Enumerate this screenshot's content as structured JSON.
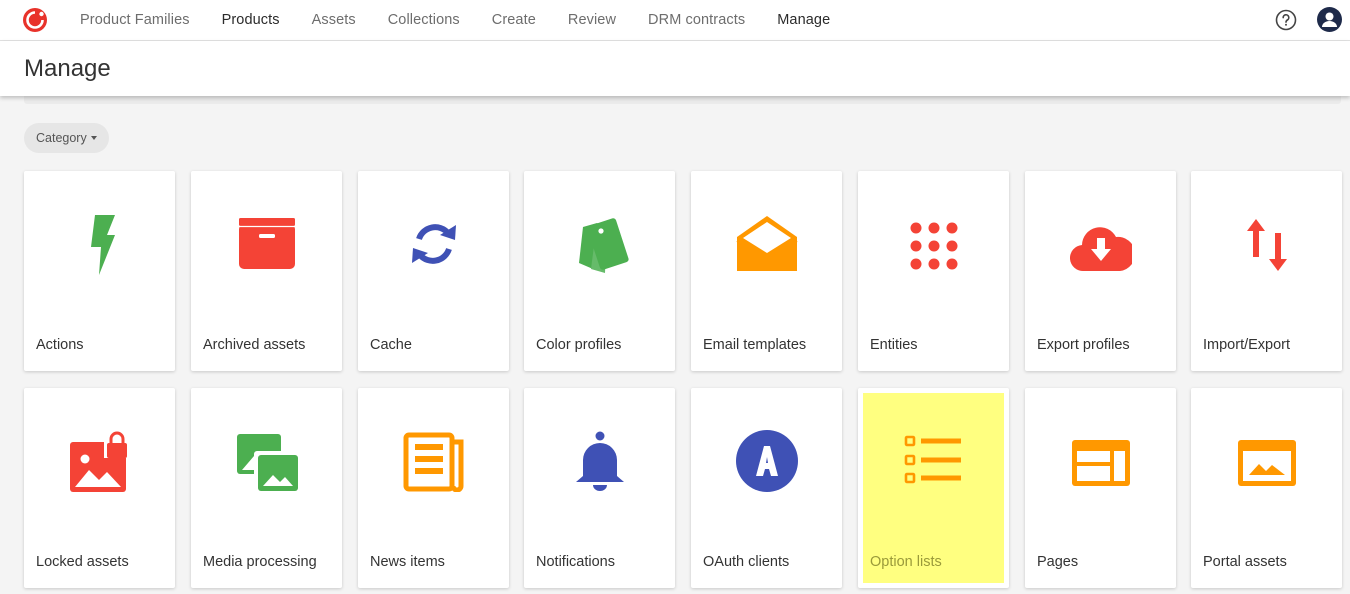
{
  "nav": {
    "items": [
      {
        "label": "Product Families",
        "dark": false
      },
      {
        "label": "Products",
        "dark": true
      },
      {
        "label": "Assets",
        "dark": false
      },
      {
        "label": "Collections",
        "dark": false
      },
      {
        "label": "Create",
        "dark": false
      },
      {
        "label": "Review",
        "dark": false
      },
      {
        "label": "DRM contracts",
        "dark": false
      },
      {
        "label": "Manage",
        "dark": true
      }
    ]
  },
  "header": {
    "title": "Manage"
  },
  "filter": {
    "category_label": "Category"
  },
  "colors": {
    "green": "#4caf50",
    "red": "#f44336",
    "blue": "#3f51b5",
    "orange": "#ff9800",
    "highlight": "#ffff80",
    "brand": "#e8322a"
  },
  "tiles": [
    {
      "label": "Actions",
      "icon": "lightning-icon"
    },
    {
      "label": "Archived assets",
      "icon": "archive-box-icon"
    },
    {
      "label": "Cache",
      "icon": "sync-icon"
    },
    {
      "label": "Color profiles",
      "icon": "color-swatches-icon"
    },
    {
      "label": "Email templates",
      "icon": "open-envelope-icon"
    },
    {
      "label": "Entities",
      "icon": "dot-grid-icon"
    },
    {
      "label": "Export profiles",
      "icon": "cloud-download-icon"
    },
    {
      "label": "Import/Export",
      "icon": "up-down-arrows-icon"
    },
    {
      "label": "Locked assets",
      "icon": "locked-image-icon"
    },
    {
      "label": "Media processing",
      "icon": "photo-library-icon"
    },
    {
      "label": "News items",
      "icon": "newspaper-icon"
    },
    {
      "label": "Notifications",
      "icon": "bell-icon"
    },
    {
      "label": "OAuth clients",
      "icon": "letter-a-circle-icon"
    },
    {
      "label": "Option lists",
      "icon": "checklist-icon",
      "highlighted": true
    },
    {
      "label": "Pages",
      "icon": "web-layout-icon"
    },
    {
      "label": "Portal assets",
      "icon": "landscape-frame-icon"
    }
  ]
}
